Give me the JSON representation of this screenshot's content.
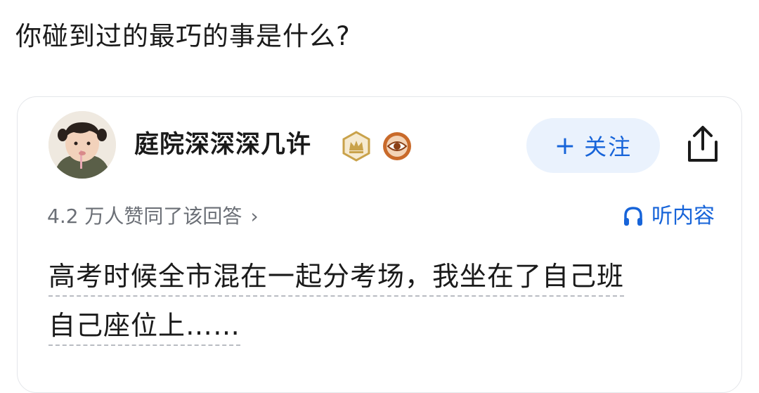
{
  "question": {
    "title": "你碰到过的最巧的事是什么?"
  },
  "answer": {
    "author": {
      "name": "庭院深深深几许",
      "badges": [
        "crown-badge-icon",
        "eye-badge-icon"
      ]
    },
    "follow_button": {
      "plus": "+",
      "label": "关注"
    },
    "share": {
      "icon": "share-icon"
    },
    "upvote_text": "4.2 万人赞同了该回答",
    "upvote_chevron": "›",
    "listen_label": "听内容",
    "content_lines": [
      "高考时候全市混在一起分考场，我坐在了自己班",
      "自己座位上……"
    ],
    "colors": {
      "accent": "#1764d9",
      "follow_bg": "#eaf2fd",
      "muted_text": "#6b6f76",
      "badge_gold": "#c9a24a",
      "badge_bronze": "#c96a2a"
    }
  }
}
